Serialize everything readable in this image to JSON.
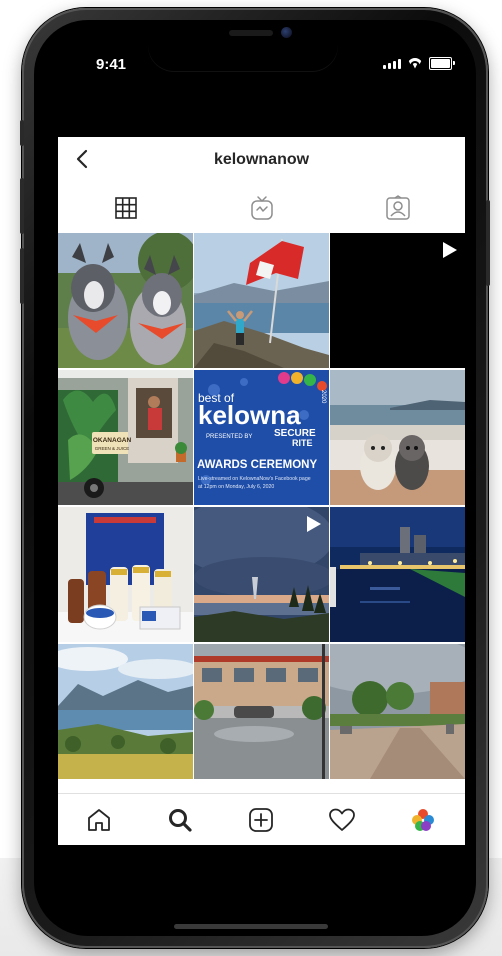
{
  "status_bar": {
    "time": "9:41"
  },
  "profile": {
    "username": "kelownanow"
  },
  "tabs": [
    {
      "id": "grid",
      "icon": "grid-icon",
      "active": true
    },
    {
      "id": "igtv",
      "icon": "igtv-icon",
      "active": false
    },
    {
      "id": "tagged",
      "icon": "tagged-icon",
      "active": false
    }
  ],
  "posts": [
    {
      "subject": "Two dogs wearing Canada bandanas",
      "video": false
    },
    {
      "subject": "Woman with Canadian flag on mountain top",
      "video": false
    },
    {
      "subject": "Video",
      "video": true
    },
    {
      "subject": "Okanagan food truck",
      "video": false
    },
    {
      "subject": "Best of Kelowna awards ceremony",
      "video": false
    },
    {
      "subject": "Dogs on a boat",
      "video": false
    },
    {
      "subject": "Dairy products",
      "video": false
    },
    {
      "subject": "Storm over the lake",
      "video": true
    },
    {
      "subject": "Marina at night",
      "video": false
    },
    {
      "subject": "Lake view from vineyard",
      "video": false
    },
    {
      "subject": "Flooded street",
      "video": false
    },
    {
      "subject": "Waterfront promenade",
      "video": false
    }
  ],
  "post4": {
    "line1": "best of",
    "line2": "kelowna",
    "year": "2020",
    "presented": "PRESENTED BY",
    "sponsor1": "SECURE",
    "sponsor2": "RITE",
    "line3": "AWARDS CEREMONY",
    "line4": "Live-streamed on KelownaNow's Facebook page",
    "line5": "at 12pm on Monday, July 6, 2020"
  },
  "post3": {
    "sign1": "OKANAGAN",
    "sign2": "GREEN & JUICE"
  },
  "nav": [
    {
      "id": "home",
      "icon": "home-icon"
    },
    {
      "id": "search",
      "icon": "search-icon",
      "active": true
    },
    {
      "id": "add",
      "icon": "add-post-icon"
    },
    {
      "id": "activity",
      "icon": "heart-icon"
    },
    {
      "id": "profile",
      "icon": "profile-avatar-icon"
    }
  ],
  "colors": {
    "text": "#262626",
    "background": "#ffffff",
    "phone_frame": "#111111",
    "awards_blue": "#1f4ea8"
  }
}
